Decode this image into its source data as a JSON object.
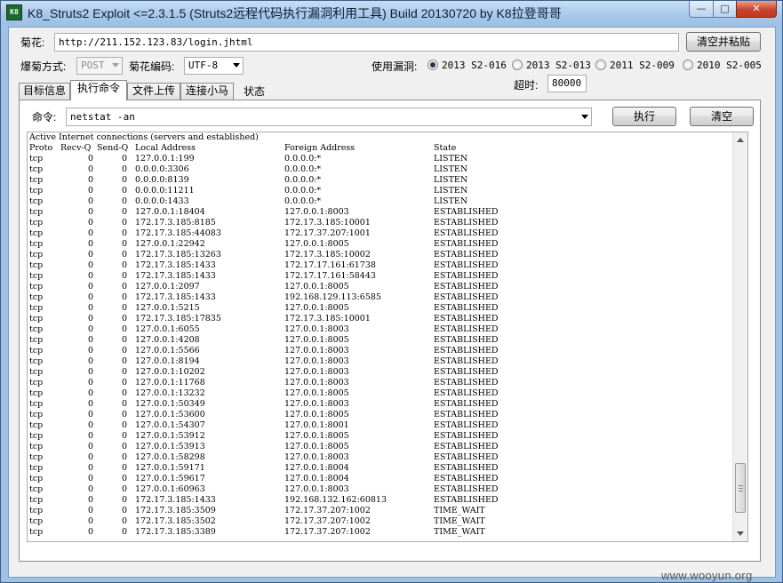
{
  "window": {
    "title": "K8_Struts2 Exploit <=2.3.1.5   (Struts2远程代码执行漏洞利用工具)  Build 20130720  by K8拉登哥哥",
    "icon_text": "K8"
  },
  "form": {
    "url_label": "菊花:",
    "url_value": "http://211.152.123.83/login.jhtml",
    "clear_paste_button": "清空并粘贴",
    "method_label": "爆菊方式:",
    "method_value": "POST",
    "encoding_label": "菊花编码:",
    "encoding_value": "UTF-8",
    "vuln_label": "使用漏洞:",
    "vuln_options": [
      {
        "label": "2013  S2-016",
        "checked": true
      },
      {
        "label": "2013  S2-013",
        "checked": false
      },
      {
        "label": "2011   S2-009",
        "checked": false
      },
      {
        "label": "2010  S2-005",
        "checked": false
      }
    ],
    "timeout_label": "超时:",
    "timeout_value": "80000"
  },
  "tabs": [
    {
      "label": "目标信息",
      "active": false
    },
    {
      "label": "执行命令",
      "active": true
    },
    {
      "label": "文件上传",
      "active": false
    },
    {
      "label": "连接小马",
      "active": false
    }
  ],
  "status_label": "状态",
  "command": {
    "label": "命令:",
    "value": "netstat -an",
    "execute_button": "执行",
    "clear_button": "清空"
  },
  "output": {
    "header": "Active Internet connections (servers and established)",
    "columns": [
      "Proto",
      "Recv-Q",
      "Send-Q",
      "Local Address",
      "Foreign Address",
      "State"
    ],
    "rows": [
      [
        "tcp",
        "0",
        "0",
        "127.0.0.1:199",
        "0.0.0.0:*",
        "LISTEN"
      ],
      [
        "tcp",
        "0",
        "0",
        "0.0.0.0:3306",
        "0.0.0.0:*",
        "LISTEN"
      ],
      [
        "tcp",
        "0",
        "0",
        "0.0.0.0:8139",
        "0.0.0.0:*",
        "LISTEN"
      ],
      [
        "tcp",
        "0",
        "0",
        "0.0.0.0:11211",
        "0.0.0.0:*",
        "LISTEN"
      ],
      [
        "tcp",
        "0",
        "0",
        "0.0.0.0:1433",
        "0.0.0.0:*",
        "LISTEN"
      ],
      [
        "tcp",
        "0",
        "0",
        "127.0.0.1:18404",
        "127.0.0.1:8003",
        "ESTABLISHED"
      ],
      [
        "tcp",
        "0",
        "0",
        "172.17.3.185:8185",
        "172.17.3.185:10001",
        "ESTABLISHED"
      ],
      [
        "tcp",
        "0",
        "0",
        "172.17.3.185:44083",
        "172.17.37.207:1001",
        "ESTABLISHED"
      ],
      [
        "tcp",
        "0",
        "0",
        "127.0.0.1:22942",
        "127.0.0.1:8005",
        "ESTABLISHED"
      ],
      [
        "tcp",
        "0",
        "0",
        "172.17.3.185:13263",
        "172.17.3.185:10002",
        "ESTABLISHED"
      ],
      [
        "tcp",
        "0",
        "0",
        "172.17.3.185:1433",
        "172.17.17.161:61738",
        "ESTABLISHED"
      ],
      [
        "tcp",
        "0",
        "0",
        "172.17.3.185:1433",
        "172.17.17.161:58443",
        "ESTABLISHED"
      ],
      [
        "tcp",
        "0",
        "0",
        "127.0.0.1:2097",
        "127.0.0.1:8005",
        "ESTABLISHED"
      ],
      [
        "tcp",
        "0",
        "0",
        "172.17.3.185:1433",
        "192.168.129.113:6585",
        "ESTABLISHED"
      ],
      [
        "tcp",
        "0",
        "0",
        "127.0.0.1:5215",
        "127.0.0.1:8005",
        "ESTABLISHED"
      ],
      [
        "tcp",
        "0",
        "0",
        "172.17.3.185:17835",
        "172.17.3.185:10001",
        "ESTABLISHED"
      ],
      [
        "tcp",
        "0",
        "0",
        "127.0.0.1:6055",
        "127.0.0.1:8003",
        "ESTABLISHED"
      ],
      [
        "tcp",
        "0",
        "0",
        "127.0.0.1:4208",
        "127.0.0.1:8005",
        "ESTABLISHED"
      ],
      [
        "tcp",
        "0",
        "0",
        "127.0.0.1:5566",
        "127.0.0.1:8003",
        "ESTABLISHED"
      ],
      [
        "tcp",
        "0",
        "0",
        "127.0.0.1:8194",
        "127.0.0.1:8003",
        "ESTABLISHED"
      ],
      [
        "tcp",
        "0",
        "0",
        "127.0.0.1:10202",
        "127.0.0.1:8003",
        "ESTABLISHED"
      ],
      [
        "tcp",
        "0",
        "0",
        "127.0.0.1:11768",
        "127.0.0.1:8003",
        "ESTABLISHED"
      ],
      [
        "tcp",
        "0",
        "0",
        "127.0.0.1:13232",
        "127.0.0.1:8005",
        "ESTABLISHED"
      ],
      [
        "tcp",
        "0",
        "0",
        "127.0.0.1:50349",
        "127.0.0.1:8003",
        "ESTABLISHED"
      ],
      [
        "tcp",
        "0",
        "0",
        "127.0.0.1:53600",
        "127.0.0.1:8005",
        "ESTABLISHED"
      ],
      [
        "tcp",
        "0",
        "0",
        "127.0.0.1:54307",
        "127.0.0.1:8001",
        "ESTABLISHED"
      ],
      [
        "tcp",
        "0",
        "0",
        "127.0.0.1:53912",
        "127.0.0.1:8005",
        "ESTABLISHED"
      ],
      [
        "tcp",
        "0",
        "0",
        "127.0.0.1:53913",
        "127.0.0.1:8005",
        "ESTABLISHED"
      ],
      [
        "tcp",
        "0",
        "0",
        "127.0.0.1:58298",
        "127.0.0.1:8003",
        "ESTABLISHED"
      ],
      [
        "tcp",
        "0",
        "0",
        "127.0.0.1:59171",
        "127.0.0.1:8004",
        "ESTABLISHED"
      ],
      [
        "tcp",
        "0",
        "0",
        "127.0.0.1:59617",
        "127.0.0.1:8004",
        "ESTABLISHED"
      ],
      [
        "tcp",
        "0",
        "0",
        "127.0.0.1:60963",
        "127.0.0.1:8003",
        "ESTABLISHED"
      ],
      [
        "tcp",
        "0",
        "0",
        "172.17.3.185:1433",
        "192.168.132.162:60813",
        "ESTABLISHED"
      ],
      [
        "tcp",
        "0",
        "0",
        "172.17.3.185:3509",
        "172.17.37.207:1002",
        "TIME_WAIT"
      ],
      [
        "tcp",
        "0",
        "0",
        "172.17.3.185:3502",
        "172.17.37.207:1002",
        "TIME_WAIT"
      ],
      [
        "tcp",
        "0",
        "0",
        "172.17.3.185:3389",
        "172.17.37.207:1002",
        "TIME_WAIT"
      ]
    ]
  },
  "watermark": "www.wooyun.org"
}
